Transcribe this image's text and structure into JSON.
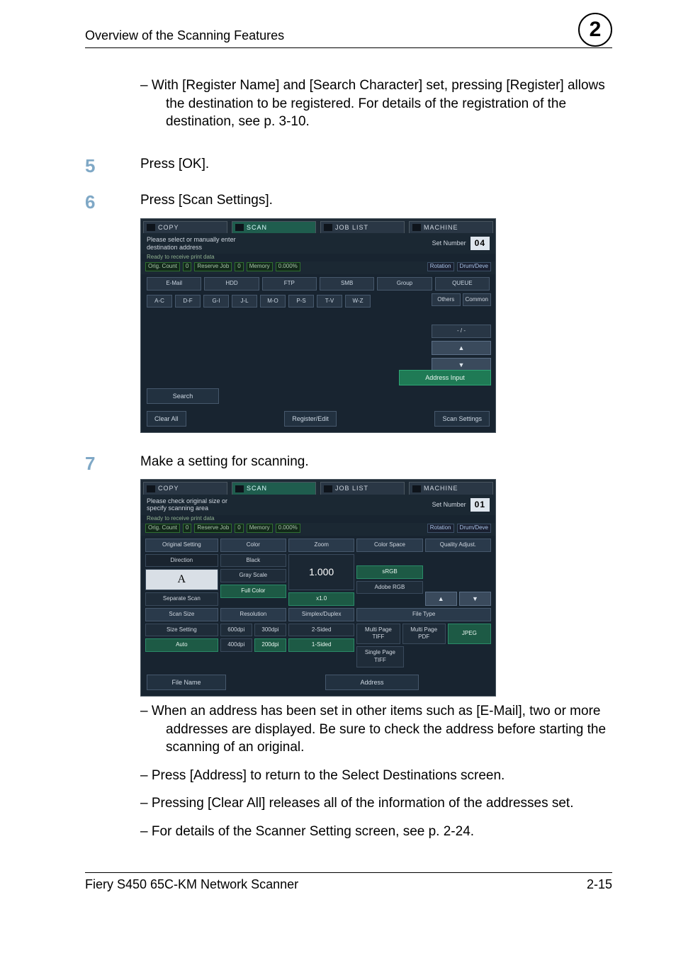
{
  "header": {
    "title": "Overview of the Scanning Features",
    "chapter": "2"
  },
  "intro_dash": "–   With [Register Name] and [Search Character] set, pressing [Register] allows the destination to be registered. For details of the registration of the destination, see p. 3-10.",
  "steps": {
    "s5": {
      "num": "5",
      "text": "Press [OK]."
    },
    "s6": {
      "num": "6",
      "text": "Press [Scan Settings]."
    },
    "s7": {
      "num": "7",
      "text": "Make a setting for scanning."
    }
  },
  "notes": {
    "n1": "–   When an address has been set in other items such as [E-Mail], two or more addresses are displayed. Be sure to check the address before starting the scanning of an original.",
    "n2": "–   Press [Address] to return to the Select Destinations screen.",
    "n3": "–   Pressing [Clear All] releases all of the information of the addresses set.",
    "n4": "–   For details of the Scanner Setting screen, see p. 2-24."
  },
  "footer": {
    "left": "Fiery S450 65C-KM Network Scanner",
    "right": "2-15"
  },
  "tabs": {
    "copy": "COPY",
    "scan": "SCAN",
    "joblist": "JOB LIST",
    "machine": "MACHINE"
  },
  "screen1": {
    "msg": "Please select or manually enter\ndestination address",
    "ready": "Ready to receive print data",
    "setnum_label": "Set Number",
    "setnum_value": "04",
    "status": {
      "orig": "Orig. Count",
      "orig_v": "0",
      "reserve": "Reserve Job",
      "reserve_v": "0",
      "memory": "Memory",
      "memory_v": "0.000%",
      "rotation": "Rotation",
      "drum": "Drum/Deve"
    },
    "dest": {
      "email": "E-Mail",
      "hdd": "HDD",
      "ftp": "FTP",
      "smb": "SMB",
      "group": "Group",
      "queue": "QUEUE"
    },
    "alpha": [
      "A-C",
      "D-F",
      "G-I",
      "J-L",
      "M-O",
      "P-S",
      "T-V",
      "W-Z"
    ],
    "side": {
      "others": "Others",
      "common": "Common",
      "page": "- / -"
    },
    "addr_input": "Address Input",
    "search": "Search",
    "clear_all": "Clear All",
    "register": "Register/Edit",
    "scan_settings": "Scan Settings"
  },
  "screen2": {
    "msg": "Please check original size or\nspecify scanning area",
    "ready": "Ready to receive print data",
    "setnum_label": "Set Number",
    "setnum_value": "01",
    "status": {
      "orig": "Orig. Count",
      "orig_v": "0",
      "reserve": "Reserve Job",
      "reserve_v": "0",
      "memory": "Memory",
      "memory_v": "0.000%",
      "rotation": "Rotation",
      "drum": "Drum/Deve"
    },
    "headers": {
      "orig_set": "Original Setting",
      "color": "Color",
      "zoom": "Zoom",
      "cspace": "Color Space",
      "quality": "Quality Adjust.",
      "scan_size": "Scan Size",
      "resolution": "Resolution",
      "simplex": "Simplex/Duplex",
      "filetype": "File Type"
    },
    "vals": {
      "direction": "Direction",
      "A": "A",
      "black": "Black",
      "gray": "Gray Scale",
      "fullcolor": "Full Color",
      "zoom_val": "1.000",
      "x1": "x1.0",
      "srgb": "sRGB",
      "adobe": "Adobe RGB",
      "sep_scan": "Separate Scan",
      "size_set": "Size Setting",
      "auto": "Auto",
      "r600": "600dpi",
      "r300": "300dpi",
      "r400": "400dpi",
      "r200": "200dpi",
      "two_sided": "2-Sided",
      "one_sided": "1-Sided",
      "mp_tiff": "Multi Page TIFF",
      "mp_pdf": "Multi Page PDF",
      "jpeg": "JPEG",
      "sp_tiff": "Single Page TIFF",
      "file_name": "File Name",
      "address": "Address"
    }
  }
}
